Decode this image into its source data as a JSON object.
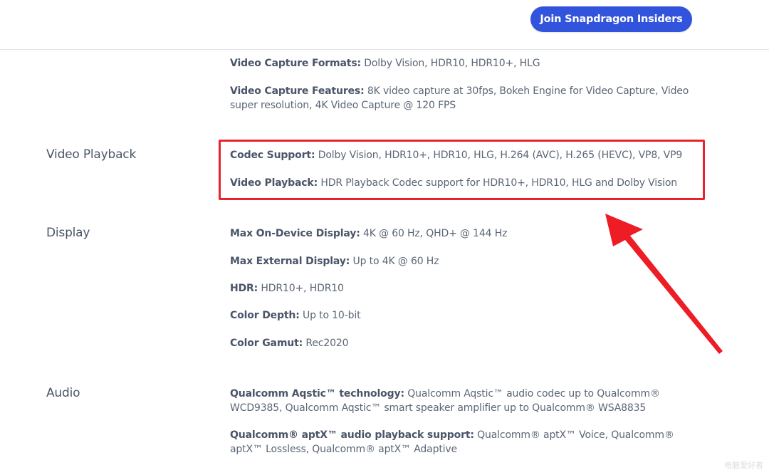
{
  "header": {
    "cta_label": "Join Snapdragon Insiders",
    "cta_color": "#3253dc"
  },
  "sections": {
    "video_capture": {
      "items": [
        {
          "key": "Video Capture Formats:",
          "value": " Dolby Vision, HDR10, HDR10+, HLG"
        },
        {
          "key": "Video Capture Features:",
          "value": " 8K video capture at 30fps, Bokeh Engine for Video Capture, Video super resolution, 4K Video Capture @ 120 FPS"
        }
      ]
    },
    "video_playback": {
      "label": "Video Playback",
      "items": [
        {
          "key": "Codec Support:",
          "value": " Dolby Vision, HDR10+, HDR10, HLG, H.264 (AVC), H.265 (HEVC), VP8, VP9"
        },
        {
          "key": "Video Playback:",
          "value": " HDR Playback Codec support for HDR10+, HDR10, HLG and Dolby Vision"
        }
      ]
    },
    "display": {
      "label": "Display",
      "items": [
        {
          "key": "Max On-Device Display:",
          "value": " 4K @ 60 Hz, QHD+ @ 144 Hz"
        },
        {
          "key": "Max External Display:",
          "value": " Up to 4K @ 60 Hz"
        },
        {
          "key": "HDR:",
          "value": " HDR10+, HDR10"
        },
        {
          "key": "Color Depth:",
          "value": " Up to 10-bit"
        },
        {
          "key": "Color Gamut:",
          "value": " Rec2020"
        }
      ]
    },
    "audio": {
      "label": "Audio",
      "items": [
        {
          "key": "Qualcomm Aqstic™ technology:",
          "value": " Qualcomm Aqstic™ audio codec up to Qualcomm® WCD9385, Qualcomm Aqstic™ smart speaker amplifier up to Qualcomm® WSA8835"
        },
        {
          "key": "Qualcomm® aptX™ audio playback support:",
          "value": " Qualcomm® aptX™ Voice, Qualcomm® aptX™ Lossless, Qualcomm® aptX™ Adaptive"
        }
      ]
    }
  },
  "annotation": {
    "highlight_color": "#e8232f",
    "arrow_color": "#ee1c25"
  },
  "watermark": {
    "text": "电脑爱好者"
  }
}
